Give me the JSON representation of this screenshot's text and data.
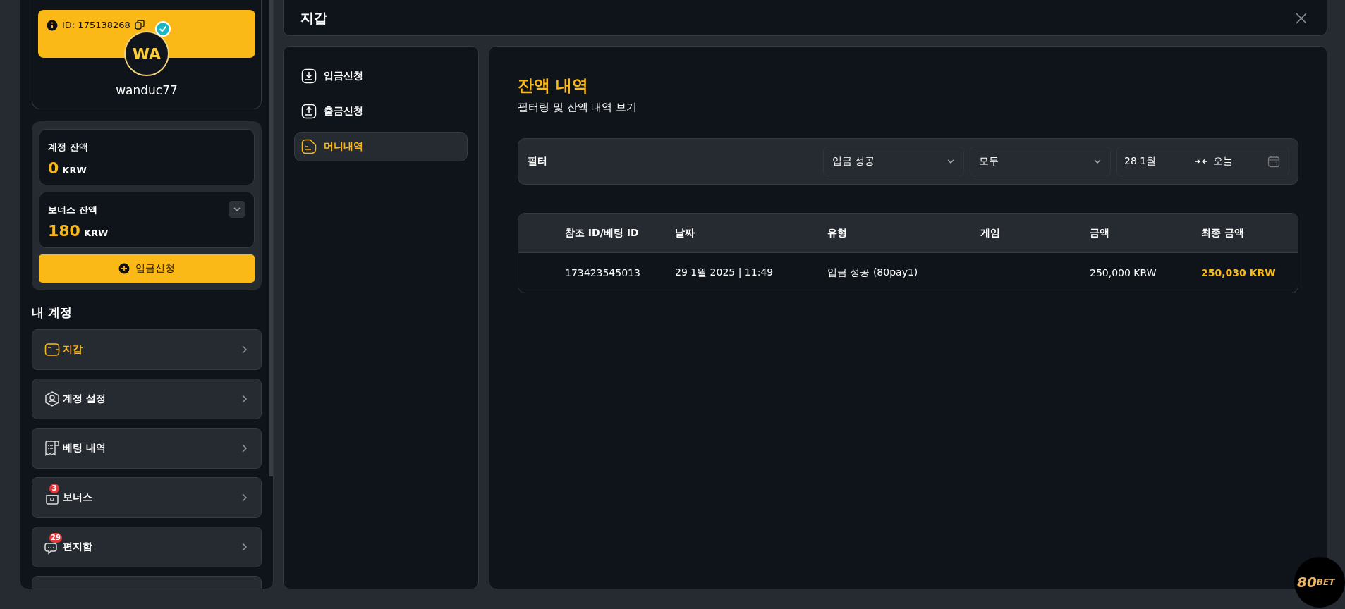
{
  "profile": {
    "id_label": "ID: 175138268",
    "avatar_initials": "WA",
    "verified": true,
    "username": "wanduc77"
  },
  "balances": [
    {
      "label": "계정 잔액",
      "amount": "0",
      "currency": "KRW",
      "expandable": false
    },
    {
      "label": "보너스 잔액",
      "amount": "180",
      "currency": "KRW",
      "expandable": true
    }
  ],
  "deposit_button": "입금신청",
  "account_section": {
    "title": "내 계정",
    "items": [
      {
        "label": "지갑",
        "kind": "wallet",
        "selected": true
      },
      {
        "label": "계정 설정",
        "kind": "user",
        "selected": false
      },
      {
        "label": "베팅 내역",
        "kind": "receipt",
        "selected": false
      },
      {
        "label": "보너스",
        "kind": "gift",
        "selected": false,
        "badge": "3"
      },
      {
        "label": "편지함",
        "kind": "chat",
        "selected": false,
        "badge": "29"
      }
    ]
  },
  "dialog": {
    "title": "지갑"
  },
  "wallet_menu": [
    {
      "label": "입금신청",
      "kind": "deposit",
      "selected": false
    },
    {
      "label": "출금신청",
      "kind": "withdraw",
      "selected": false
    },
    {
      "label": "머니내역",
      "kind": "history",
      "selected": true
    }
  ],
  "content": {
    "title": "잔액 내역",
    "subtitle": "필터링 및 잔액 내역 보기",
    "filter": {
      "label": "필터",
      "type_select": "입금 성공",
      "status_select": "모두",
      "date_from": "28 1월",
      "date_to": "오늘"
    }
  },
  "table": {
    "columns": [
      "참조 ID/베팅 ID",
      "날짜",
      "유형",
      "게임",
      "금액",
      "최종 금액"
    ],
    "rows": [
      {
        "reference": "173423545013",
        "date": "29 1월 2025 | 11:49",
        "type": "입금 성공 (80pay1)",
        "amount": "250,000 KRW",
        "final_amount": "250,030 KRW"
      }
    ]
  },
  "logo": {
    "number": "80",
    "word": "BET"
  }
}
